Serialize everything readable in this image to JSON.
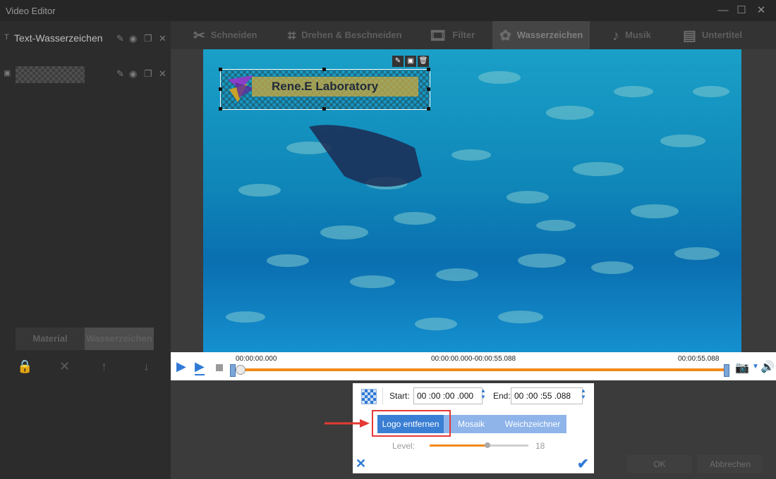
{
  "window": {
    "title": "Video Editor"
  },
  "left_panel": {
    "title": "Text-Wasserzeichen",
    "tabs": [
      {
        "label": "Material"
      },
      {
        "label": "Wasserzeichen"
      }
    ]
  },
  "toolbar": {
    "tools": [
      {
        "label": "Schneiden",
        "icon": "scissors-icon"
      },
      {
        "label": "Drehen & Beschneiden",
        "icon": "crop-rotate-icon"
      },
      {
        "label": "Filter",
        "icon": "filter-icon"
      },
      {
        "label": "Wasserzeichen",
        "icon": "watermark-reel-icon",
        "active": true
      },
      {
        "label": "Musik",
        "icon": "music-note-icon"
      },
      {
        "label": "Untertitel",
        "icon": "subtitle-icon"
      }
    ]
  },
  "watermark": {
    "text": "Rene.E Laboratory"
  },
  "timeline": {
    "start_time": "00:00:00.000",
    "range": "00:00:00.000-00:00:55.088",
    "end_time": "00:00:55.088"
  },
  "dialog": {
    "start_label": "Start:",
    "start_value": "00 :00 :00 .000",
    "end_label": "End:",
    "end_value": "00 :00 :55 .088",
    "modes": [
      {
        "label": "Logo entfernen",
        "active": true
      },
      {
        "label": "Mosaik"
      },
      {
        "label": "Weichzeichner"
      }
    ],
    "level_label": "Level:",
    "level_value": "18"
  },
  "footer": {
    "ok_label": "OK",
    "cancel_label": "Abbrechen"
  },
  "colors": {
    "accent": "#2f7ad6",
    "progress": "#f28a1a",
    "highlight": "#e53935"
  }
}
